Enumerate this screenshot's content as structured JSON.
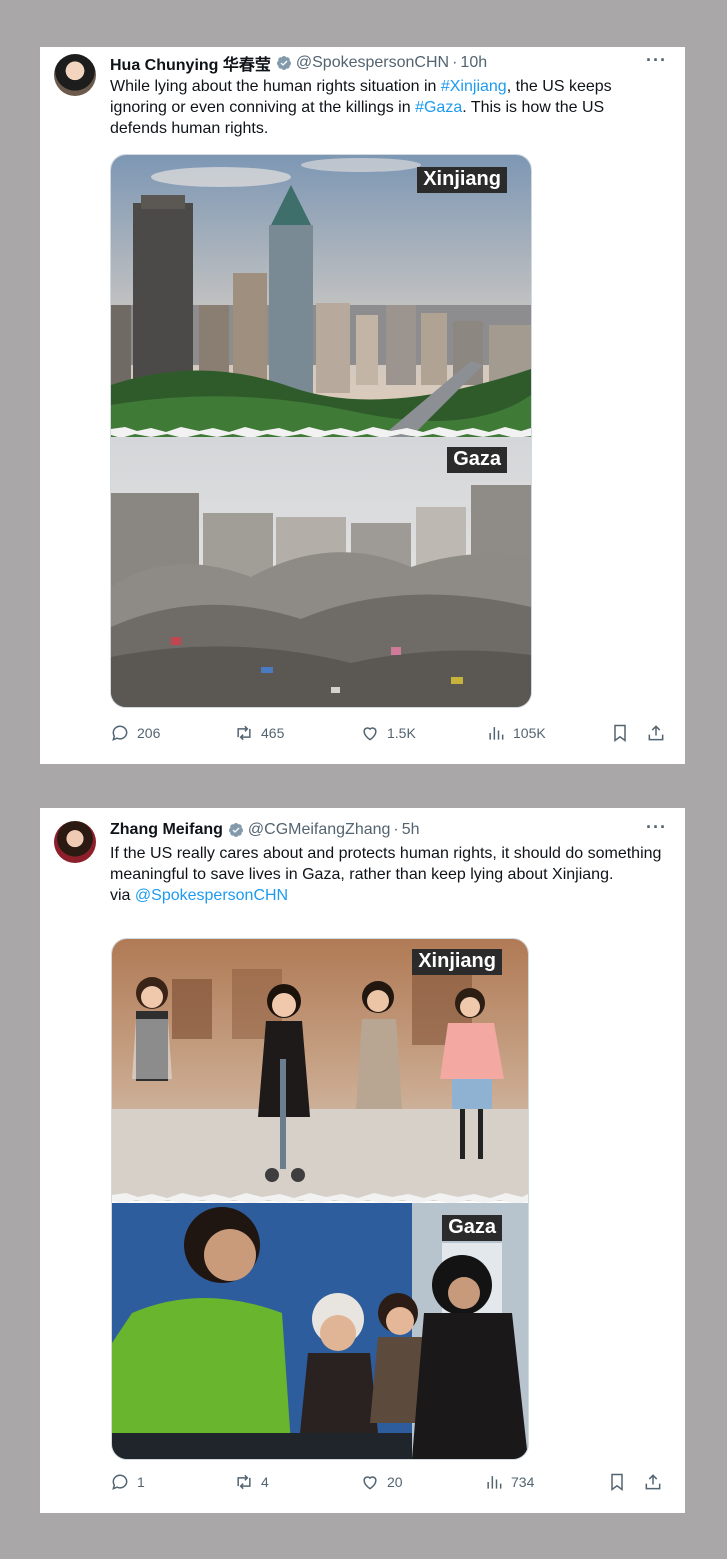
{
  "tweets": [
    {
      "name": "Hua Chunying 华春莹",
      "handle": "@SpokespersonCHN",
      "separator": "·",
      "time": "10h",
      "more": "···",
      "text_parts": [
        "While lying about the human rights situation in ",
        "#Xinjiang",
        ", the US keeps ignoring or even conniving at the killings in ",
        "#Gaza",
        ". This is how the US defends human rights."
      ],
      "image_labels": {
        "top": "Xinjiang",
        "bottom": "Gaza"
      },
      "stats": {
        "replies": "206",
        "reposts": "465",
        "likes": "1.5K",
        "views": "105K"
      }
    },
    {
      "name": "Zhang Meifang",
      "handle": "@CGMeifangZhang",
      "separator": "·",
      "time": "5h",
      "more": "···",
      "text": "If the US really cares about and protects human rights, it should do something meaningful to save lives in Gaza, rather than keep lying about Xinjiang.",
      "via_prefix": "via ",
      "via_link": "@SpokespersonCHN",
      "image_labels": {
        "top": "Xinjiang",
        "bottom": "Gaza"
      },
      "stats": {
        "replies": "1",
        "reposts": "4",
        "likes": "20",
        "views": "734"
      }
    }
  ],
  "colors": {
    "link": "#1d9bf0",
    "verified": "#829aab",
    "muted": "#536471",
    "background": "#a9a7a8"
  },
  "icons": [
    "verified-badge-icon",
    "more-icon",
    "reply-icon",
    "repost-icon",
    "like-icon",
    "views-icon",
    "bookmark-icon",
    "share-icon"
  ]
}
